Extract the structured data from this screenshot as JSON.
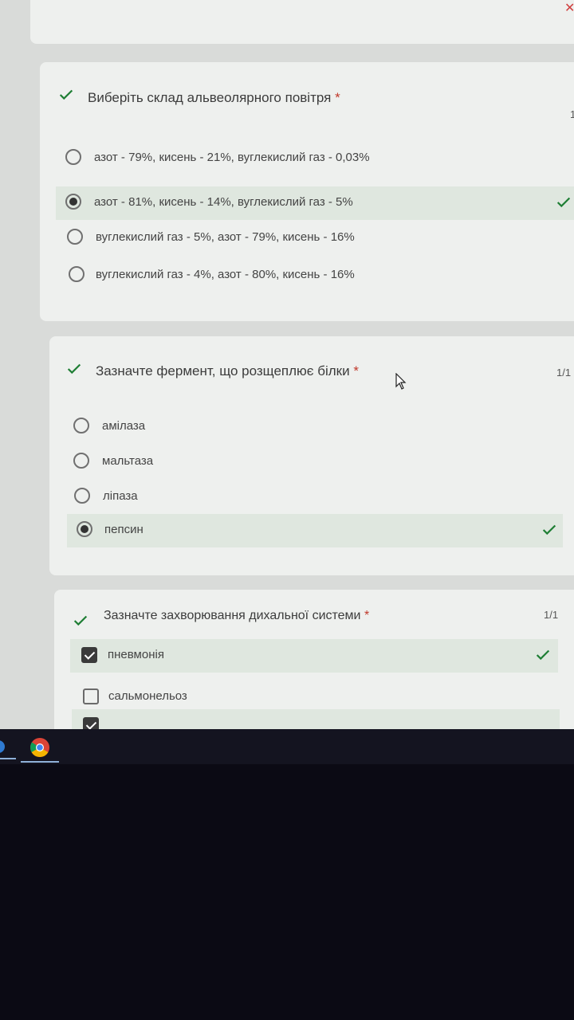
{
  "questions": [
    {
      "title": "Виберіть склад альвеолярного повітря",
      "required_mark": "*",
      "score": "1",
      "options": [
        "азот - 79%, кисень - 21%, вуглекислий газ - 0,03%",
        "азот - 81%, кисень - 14%, вуглекислий газ - 5%",
        "вуглекислий газ - 5%, азот - 79%, кисень - 16%",
        "вуглекислий газ - 4%, азот - 80%, кисень - 16%"
      ],
      "selected_index": 1
    },
    {
      "title": "Зазначте фермент, що розщеплює білки",
      "required_mark": "*",
      "score": "1/1",
      "options": [
        "амілаза",
        "мальтаза",
        "ліпаза",
        "пепсин"
      ],
      "selected_index": 3
    },
    {
      "title": "Зазначте захворювання дихальної системи",
      "required_mark": "*",
      "score": "1/1",
      "options": [
        "пневмонія",
        "сальмонельоз"
      ],
      "checked": [
        true,
        false
      ]
    }
  ],
  "colors": {
    "accent_check": "#1e7e34",
    "selected_bg": "#dfe7df"
  },
  "icons": {
    "close": "close-icon",
    "taskbar_app": "chrome-icon"
  }
}
